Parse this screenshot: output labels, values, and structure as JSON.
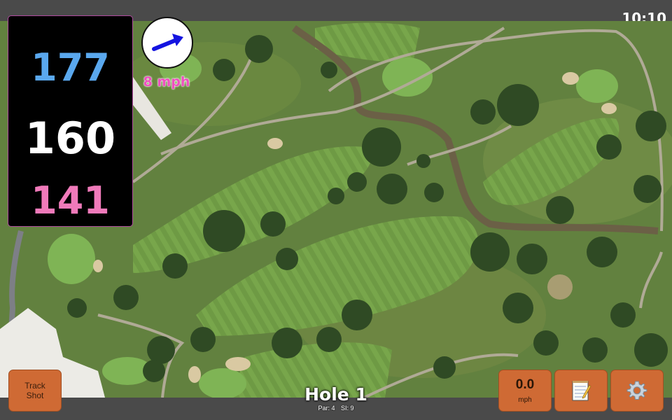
{
  "status": {
    "time": "10:10"
  },
  "distances": {
    "back": "177",
    "middle": "160",
    "front": "141"
  },
  "wind": {
    "speed_label": "8 mph",
    "direction_icon": "arrow-up-right-icon"
  },
  "hole": {
    "title": "Hole 1",
    "par_label": "Par: 4",
    "si_label": "SI: 9"
  },
  "buttons": {
    "track_shot_line1": "Track",
    "track_shot_line2": "Shot",
    "wind_value": "0.0",
    "wind_unit": "mph",
    "notes_icon": "notepad-icon",
    "settings_icon": "gear-icon"
  },
  "colors": {
    "back_distance": "#5aa8ee",
    "middle_distance": "#ffffff",
    "front_distance": "#f07aba",
    "wind_text": "#ef50c0",
    "button": "#cf6a34"
  }
}
